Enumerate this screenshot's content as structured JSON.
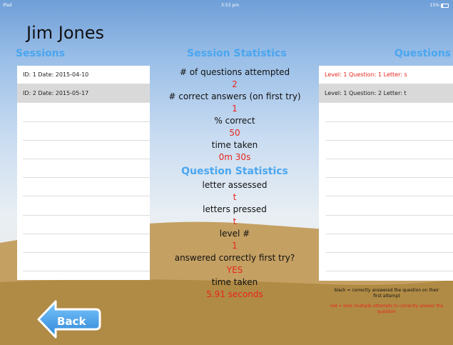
{
  "status_bar": {
    "carrier": "iPad",
    "time": "3:53 pm",
    "battery": "15%"
  },
  "user": {
    "name": "Jim Jones"
  },
  "headers": {
    "sessions": "Sessions",
    "session_statistics": "Session Statistics",
    "questions": "Questions",
    "question_statistics": "Question Statistics"
  },
  "sessions": [
    {
      "label": "ID: 1 Date: 2015-04-10"
    },
    {
      "label": "ID: 2 Date: 2015-05-17"
    }
  ],
  "questions": [
    {
      "label": "Level: 1 Question: 1 Letter: s",
      "color": "red"
    },
    {
      "label": "Level: 1 Question: 2 Letter: t",
      "color": "black"
    }
  ],
  "session_stats": {
    "attempted_label": "# of questions attempted",
    "attempted_value": "2",
    "correct_label": "# correct answers (on first try)",
    "correct_value": "1",
    "percent_label": "% correct",
    "percent_value": "50",
    "time_label": "time taken",
    "time_value": "0m 30s"
  },
  "question_stats": {
    "letter_label": "letter assessed",
    "letter_value": "t",
    "pressed_label": "letters pressed",
    "pressed_value": "t",
    "level_label": "level #",
    "level_value": "1",
    "first_try_label": "answered correctly first try?",
    "first_try_value": "YES",
    "time_label": "time taken",
    "time_value": "5.91 seconds"
  },
  "legend": {
    "black": "black = correctly answered the question on their first attempt",
    "red": "red = took multiple attempts to correctly answer the question"
  },
  "back_button": {
    "label": "Back"
  },
  "colors": {
    "accent_blue": "#4aa6f0",
    "value_red": "#e8261e",
    "sand": "#b48f4a",
    "selected_row": "#d9d9d9"
  }
}
